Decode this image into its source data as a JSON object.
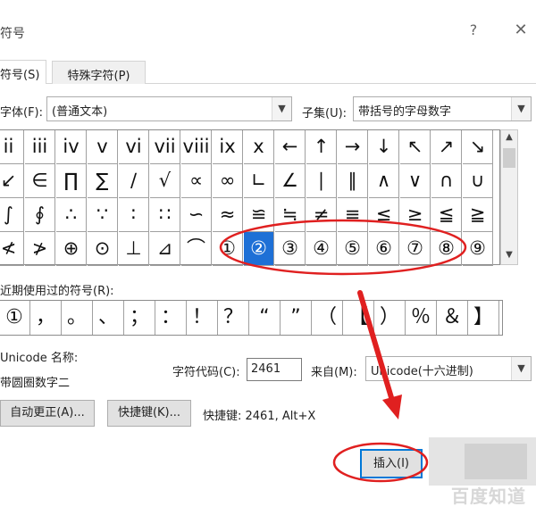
{
  "dialog": {
    "title": "符号",
    "help": "?",
    "close": "✕"
  },
  "tabs": {
    "symbols": "符号(S)",
    "special": "特殊字符(P)"
  },
  "font": {
    "label": "字体(F):",
    "value": "(普通文本)"
  },
  "subset": {
    "label": "子集(U):",
    "value": "带括号的字母数字"
  },
  "grid": {
    "rows": [
      [
        "ii",
        "iii",
        "iv",
        "v",
        "vi",
        "vii",
        "viii",
        "ix",
        "x",
        "←",
        "↑",
        "→",
        "↓",
        "↖",
        "↗",
        "↘"
      ],
      [
        "↙",
        "∈",
        "∏",
        "∑",
        "∕",
        "√",
        "∝",
        "∞",
        "∟",
        "∠",
        "∣",
        "∥",
        "∧",
        "∨",
        "∩",
        "∪"
      ],
      [
        "∫",
        "∮",
        "∴",
        "∵",
        "∶",
        "∷",
        "∽",
        "≈",
        "≌",
        "≒",
        "≠",
        "≡",
        "≤",
        "≥",
        "≦",
        "≧"
      ],
      [
        "≮",
        "≯",
        "⊕",
        "⊙",
        "⊥",
        "⊿",
        "⌒",
        "①",
        "②",
        "③",
        "④",
        "⑤",
        "⑥",
        "⑦",
        "⑧",
        "⑨"
      ]
    ],
    "selected": "②"
  },
  "recent": {
    "label": "近期使用过的符号(R):",
    "items": [
      "①",
      "，",
      "。",
      "、",
      "；",
      "：",
      "！",
      "？",
      "“",
      "”",
      "（",
      "【",
      "）",
      "％",
      "＆",
      "】"
    ]
  },
  "unicode": {
    "name_label": "Unicode 名称:",
    "name_value": "带圆圈数字二",
    "code_label": "字符代码(C):",
    "code_value": "2461",
    "from_label": "来自(M):",
    "from_value": "Unicode(十六进制)"
  },
  "buttons": {
    "autocorrect": "自动更正(A)...",
    "shortcut": "快捷键(K)...",
    "shortcut_info": "快捷键: 2461, Alt+X",
    "insert": "插入(I)"
  },
  "watermark": "百度知道",
  "colors": {
    "selection": "#1e70d6",
    "annotation": "#e02020"
  }
}
